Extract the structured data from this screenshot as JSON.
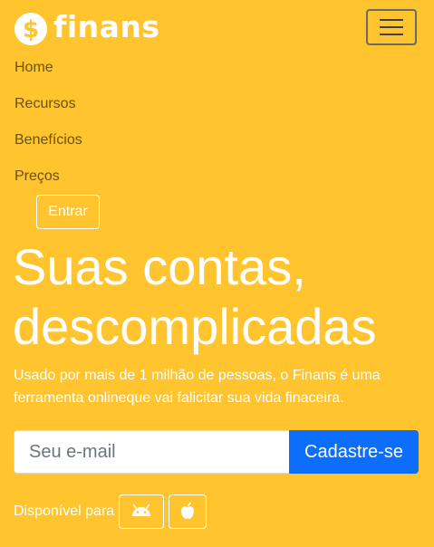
{
  "brand": {
    "name": "finans",
    "logo_icon": "dollar-coin-icon"
  },
  "navbar": {
    "toggler_icon": "hamburger-menu-icon",
    "links": [
      {
        "label": "Home"
      },
      {
        "label": "Recursos"
      },
      {
        "label": "Benefícios"
      },
      {
        "label": "Preços"
      }
    ],
    "login_label": "Entrar"
  },
  "hero": {
    "title_line1": "Suas contas,",
    "title_line2": "descomplicadas",
    "text": "Usado por mais de 1 milhão de pessoas, o Finans é uma ferramenta onlineque vai falicitar sua vida finaceira."
  },
  "signup": {
    "email_placeholder": "Seu e-mail",
    "email_value": "",
    "button_label": "Cadastre-se"
  },
  "availability": {
    "label": "Disponível para",
    "platforms": [
      {
        "icon": "android-icon"
      },
      {
        "icon": "apple-icon"
      }
    ]
  },
  "colors": {
    "background": "#ffc42e",
    "primary_button": "#0d6efd",
    "nav_link": "#6b5200"
  }
}
